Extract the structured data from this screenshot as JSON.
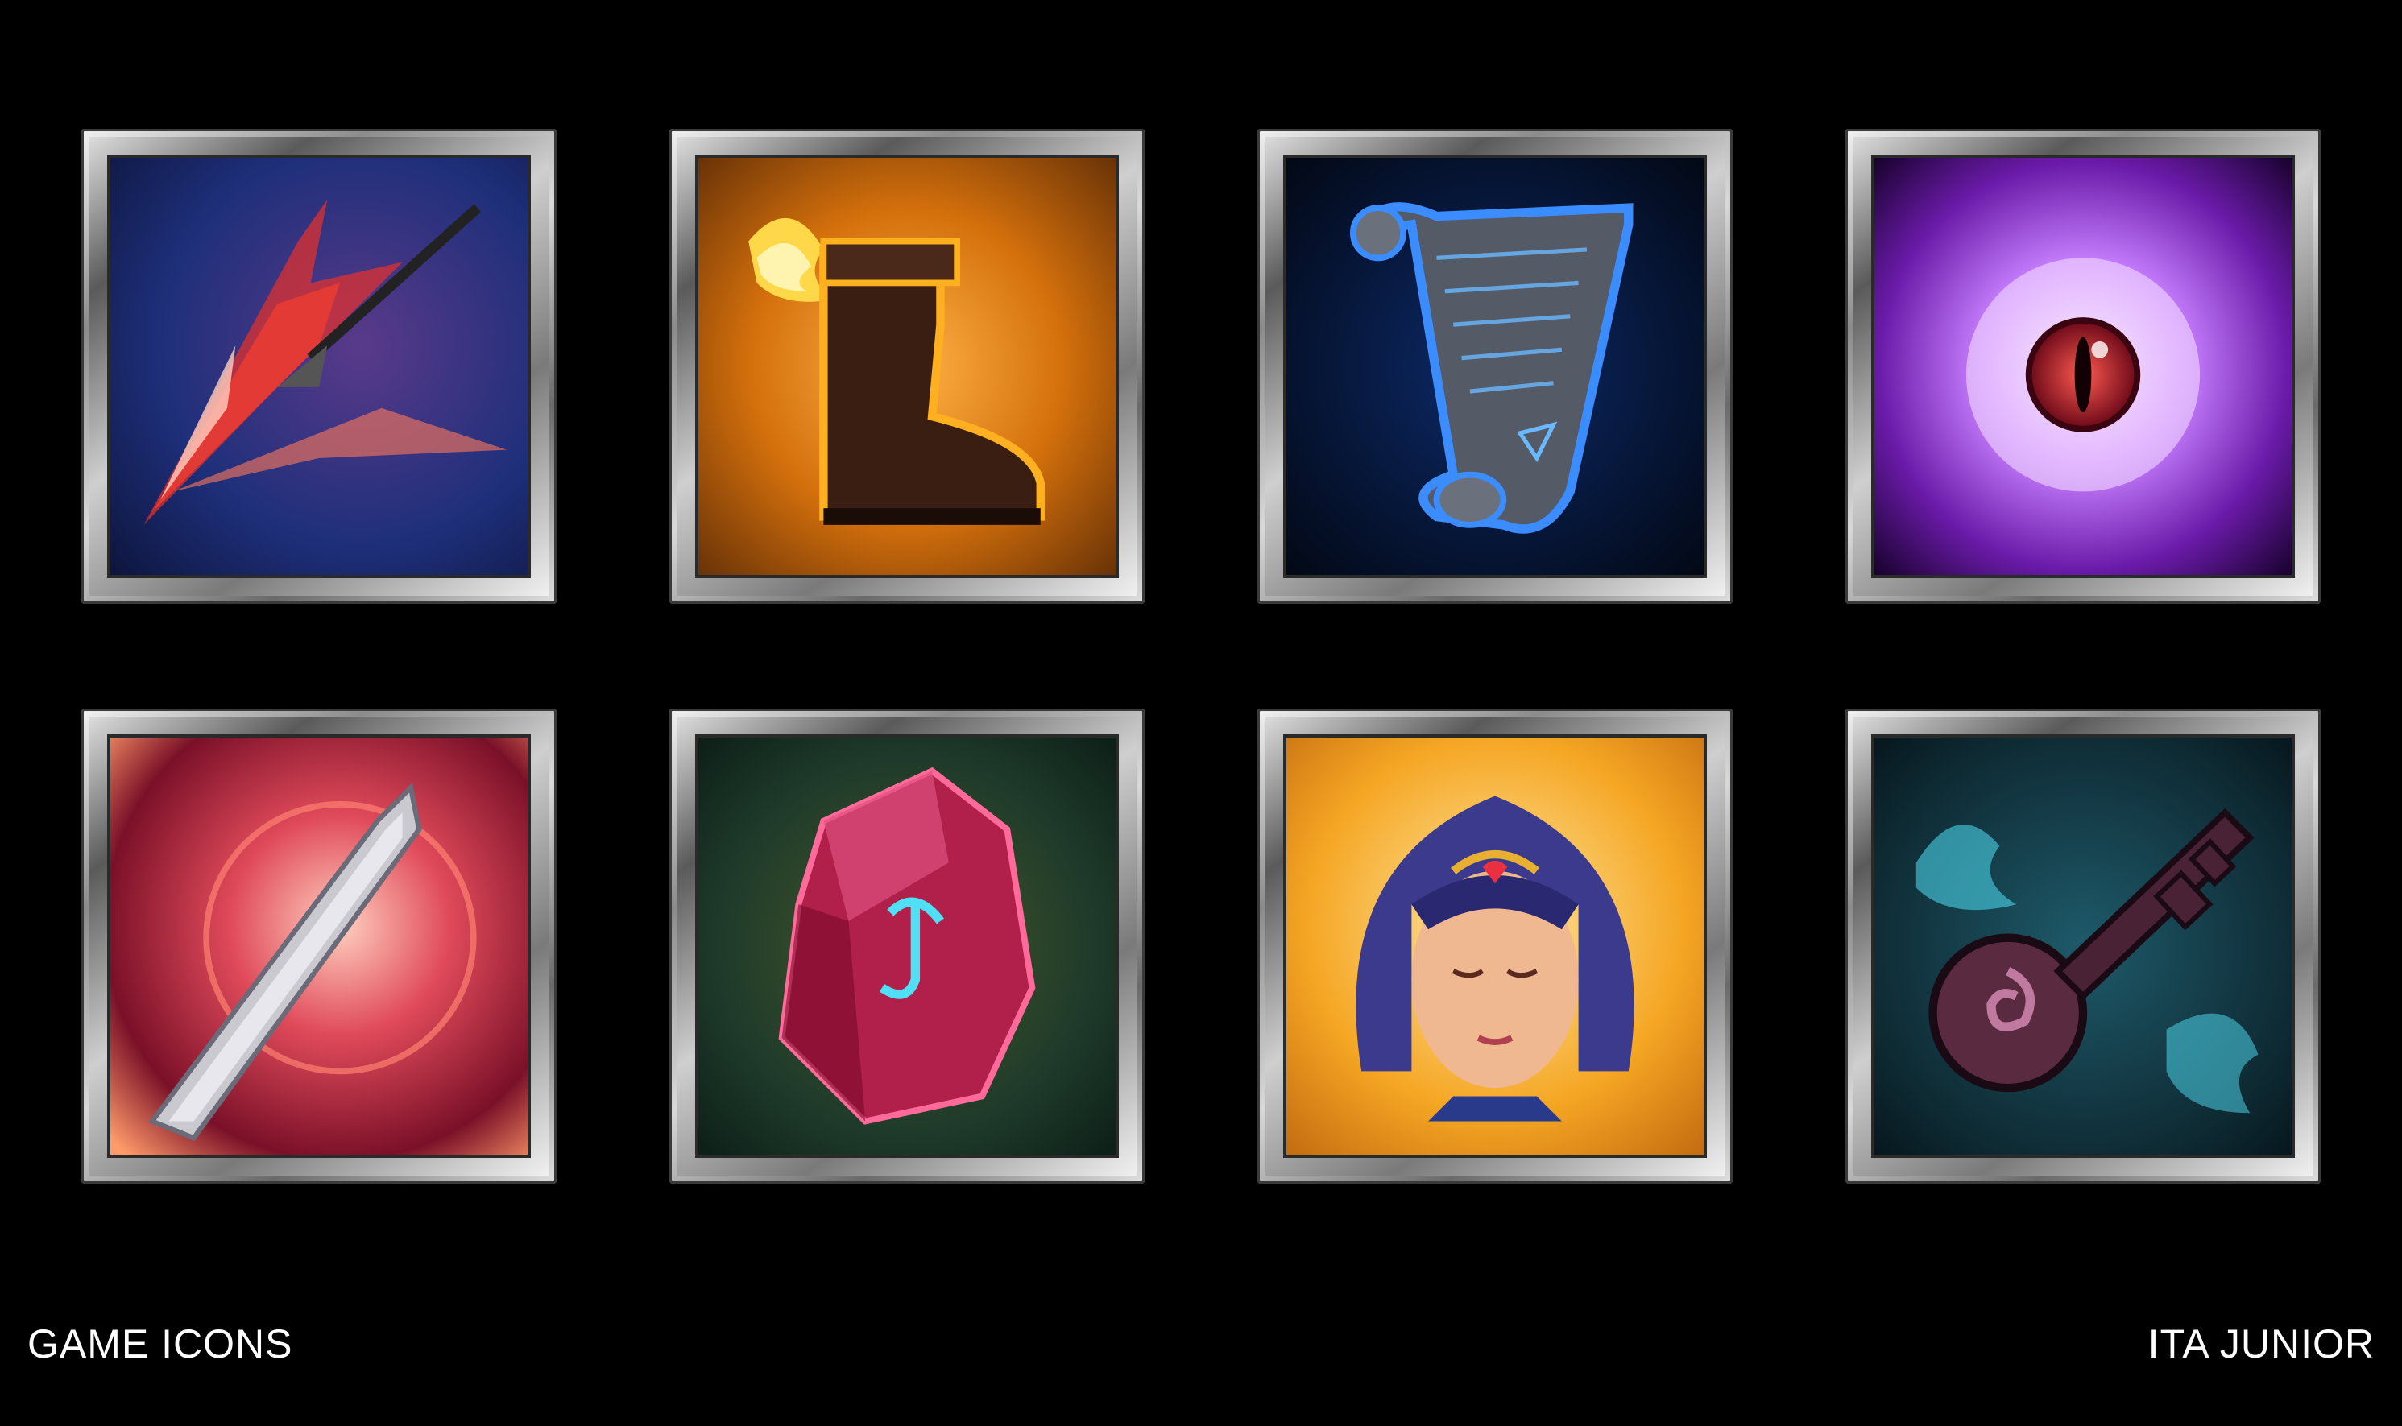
{
  "footer": {
    "title": "GAME ICONS",
    "author": "ITA JUNIOR"
  },
  "icons": [
    {
      "name": "spear-strike-icon",
      "palette": [
        "#1b2b6a",
        "#e8423a"
      ]
    },
    {
      "name": "winged-fire-boot-icon",
      "palette": [
        "#7a3a08",
        "#f5a623"
      ]
    },
    {
      "name": "magic-scroll-icon",
      "palette": [
        "#05122e",
        "#2f7bff"
      ]
    },
    {
      "name": "demon-eye-icon",
      "palette": [
        "#2a0640",
        "#c46cff"
      ]
    },
    {
      "name": "crystal-sword-icon",
      "palette": [
        "#5a0d20",
        "#ff8a7a"
      ]
    },
    {
      "name": "rune-stone-icon",
      "palette": [
        "#0e2a1e",
        "#d62a66"
      ]
    },
    {
      "name": "priestess-portrait-icon",
      "palette": [
        "#f5a623",
        "#3c3a8c"
      ]
    },
    {
      "name": "ghost-key-icon",
      "palette": [
        "#0a2a33",
        "#4fe0f5"
      ]
    }
  ]
}
